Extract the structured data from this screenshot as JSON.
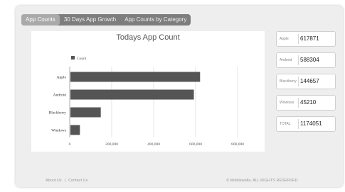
{
  "tabs": [
    {
      "label": "App Counts",
      "active": true
    },
    {
      "label": "30 Days App Growth",
      "active": false
    },
    {
      "label": "App Counts by Category",
      "active": false
    }
  ],
  "chart_data": {
    "type": "bar",
    "orientation": "horizontal",
    "title": "Todays App Count",
    "categories": [
      "Apple",
      "Android",
      "Blackberry",
      "Windows"
    ],
    "series": [
      {
        "name": "Count",
        "values": [
          617871,
          588304,
          144657,
          45210
        ]
      }
    ],
    "xlim": [
      0,
      800000
    ],
    "xticks": [
      "0",
      "200,000",
      "400,000",
      "600,000",
      "800,000"
    ],
    "grid": true,
    "legend": "top-left",
    "colors": {
      "bar": "#555555",
      "grid": "#dddddd"
    }
  },
  "stats": [
    {
      "label": "Apple",
      "value": "617871"
    },
    {
      "label": "Android",
      "value": "588304"
    },
    {
      "label": "Blackberry",
      "value": "144657"
    },
    {
      "label": "Windows",
      "value": "45210"
    },
    {
      "label": "TOTAL",
      "value": "1174051"
    }
  ],
  "footer": {
    "about": "About Us",
    "separator": "|",
    "contact": "Contact Us",
    "copyright": "© Mobilewalla. ALL RIGHTS RESERVED"
  }
}
